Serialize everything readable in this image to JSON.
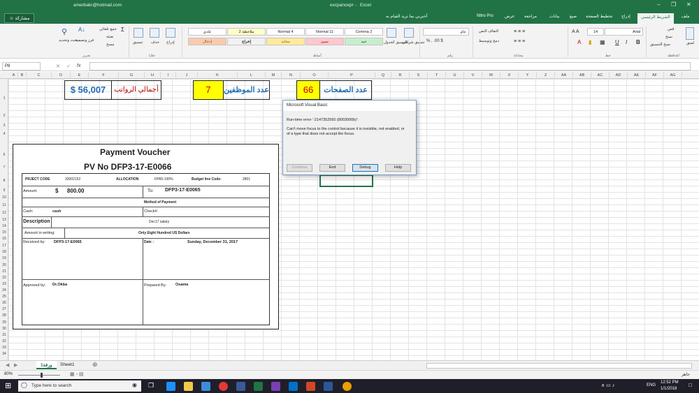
{
  "title_bar": {
    "email": "amerbakr@hotmail.com",
    "file": "excpancepr",
    "app_sep": "-",
    "app": "Excel"
  },
  "tabs": {
    "file": "ملف",
    "home": "الشريط الرئيسي",
    "insert": "إدراج",
    "page_layout": "تخطيط الصفحة",
    "formulas": "صيغ",
    "data": "بيانات",
    "review": "مراجعة",
    "view": "عرض",
    "nitro": "Nitro Pro",
    "tellme": "أخبرني بما تريد القيام به",
    "share": "مشاركة"
  },
  "ribbon": {
    "clipboard": {
      "paste": "لصق",
      "cut": "قص",
      "copy": "نسخ",
      "format_painter": "نسخ التنسيق",
      "group": "الحافظة"
    },
    "font": {
      "name": "Arial",
      "size": "14",
      "group": "خط"
    },
    "alignment": {
      "wrap": "التفاف النص",
      "merge": "دمج وتوسيط",
      "group": "محاذاة"
    },
    "number": {
      "format": "عام",
      "group": "رقم"
    },
    "styles": {
      "conditional": "تنسيق شرطي",
      "as_table": "التنسيق كجدول",
      "cell_styles": [
        "Comma 2",
        "Normal 11",
        "Normal 4",
        "ملاحظة 2",
        "عادي"
      ],
      "cell_styles_row2": [
        "جيد",
        "سيئ",
        "محايد",
        "إخراج",
        "إدخال"
      ],
      "group": "أنماط"
    },
    "cells": {
      "insert": "إدراج",
      "delete": "حذف",
      "format": "تنسيق",
      "group": "خلايا"
    },
    "editing": {
      "autosum": "جمع تلقائي",
      "fill": "تعبئة",
      "clear": "مسح",
      "sort": "فرز وتصفية",
      "find": "بحث وتحديد",
      "group": "تحرير"
    }
  },
  "formula_bar": {
    "name_box": "P8",
    "fx": "fx"
  },
  "columns": [
    "A",
    "B",
    "C",
    "D",
    "E",
    "F",
    "G",
    "H",
    "I",
    "J",
    "K",
    "L",
    "M",
    "N",
    "O",
    "P",
    "Q",
    "R",
    "S",
    "T",
    "U",
    "V",
    "W",
    "X",
    "Y",
    "Z",
    "AA",
    "AB",
    "AC",
    "AD",
    "AE",
    "AF",
    "AG"
  ],
  "rows": [
    "1",
    "2",
    "3",
    "4",
    "5",
    "7",
    "8",
    "9",
    "10",
    "11",
    "12",
    "13",
    "14",
    "15",
    "16",
    "17",
    "18",
    "19",
    "20",
    "21",
    "22",
    "23",
    "24",
    "25",
    "26",
    "27",
    "28",
    "29",
    "30",
    "31",
    "32",
    "33",
    "34",
    "35",
    "36"
  ],
  "summary": {
    "total_salaries_value": "$ 56,007",
    "total_salaries_label": "أجمالي الرواتب",
    "employees_value": "7",
    "employees_label": "عدد الموظفين",
    "pages_value": "66",
    "pages_label": "عدد الصفحات"
  },
  "voucher": {
    "title": "Payment Voucher",
    "pv_no": "PV No  DFP3-17-E0066",
    "project_code_label": "PRJECT CODE",
    "project_code": "33002152",
    "allocation_label": "ALLOCATION",
    "allocation": "FPA5-100%",
    "budget_label": "Budget line Code:",
    "budget": "2801",
    "amount_label": "Amount:",
    "amount_currency": "$",
    "amount": "800.00",
    "to_label": "To:",
    "to": "DFP3-17-E0065",
    "method_label": "Method of Payment",
    "cash_label": "Cash:",
    "cash": "cash",
    "check_label": "Check#:",
    "description_label": "Description",
    "description": "Dec17 salary",
    "amount_words_label": "Amount in writing:",
    "amount_words": "Only Eight Hundred  US Dollars",
    "received_label": "Received by:",
    "received": "DFP3-17-E0065",
    "date_label": "Date :",
    "date": "Sunday, December 31, 2017",
    "approved_label": "Approved  by:",
    "approved": "Dr.Okba",
    "prepared_label": "Prepared By:",
    "prepared": "Osama"
  },
  "dialog": {
    "title": "Microsoft Visual Basic",
    "error": "Run-time error '-2147352565 (8003000b)':",
    "message_line1": "Can't move focus to the control because it is invisible, not enabled, or",
    "message_line2": "of a type that does not accept the focus.",
    "buttons": [
      "Continue",
      "End",
      "Debug",
      "Help"
    ]
  },
  "sheets": [
    "ورقة1",
    "Sheet1"
  ],
  "status": {
    "zoom": "80%",
    "mode": "جاهز"
  },
  "taskbar": {
    "search": "Type here to search",
    "lang": "ENG",
    "time": "12:52 PM",
    "date": "1/1/2018"
  }
}
